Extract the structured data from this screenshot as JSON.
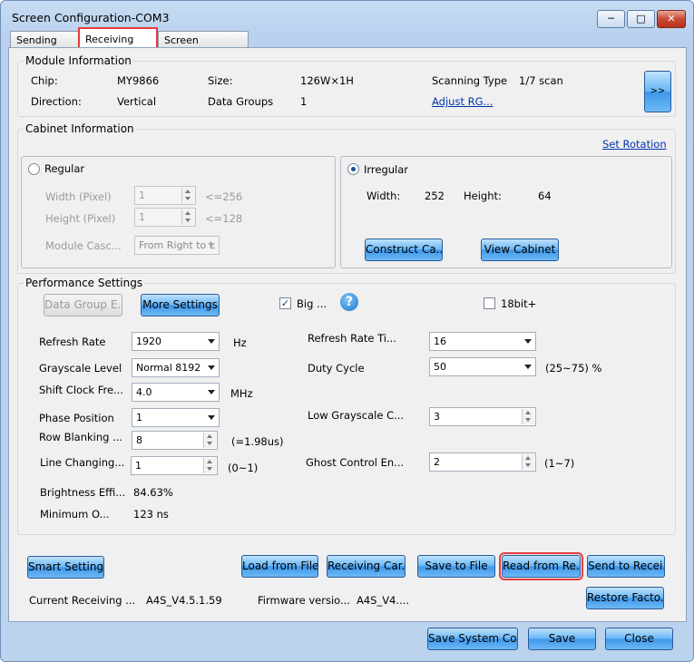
{
  "window": {
    "title": "Screen Configuration-COM3"
  },
  "tabs": [
    {
      "label": "Sending Card"
    },
    {
      "label": "Receiving Card"
    },
    {
      "label": "Screen Connection"
    }
  ],
  "module_info": {
    "legend": "Module Information",
    "chip_label": "Chip:",
    "chip_value": "MY9866",
    "size_label": "Size:",
    "size_value": "126W×1H",
    "scan_label": "Scanning Type",
    "scan_value": "1/7 scan",
    "direction_label": "Direction:",
    "direction_value": "Vertical",
    "groups_label": "Data Groups",
    "groups_value": "1",
    "adjust_link": "Adjust RG...",
    "more_button": ">>"
  },
  "cabinet_info": {
    "legend": "Cabinet Information",
    "set_rotation": "Set Rotation",
    "regular": {
      "label": "Regular",
      "width_label": "Width (Pixel)",
      "width_value": "1",
      "width_limit": "<=256",
      "height_label": "Height (Pixel)",
      "height_value": "1",
      "height_limit": "<=128",
      "cascade_label": "Module Casc...",
      "cascade_value": "From Right to L"
    },
    "irregular": {
      "label": "Irregular",
      "width_label": "Width:",
      "width_value": "252",
      "height_label": "Height:",
      "height_value": "64",
      "construct_button": "Construct Ca...",
      "view_button": "View Cabinet"
    }
  },
  "performance": {
    "legend": "Performance Settings",
    "data_group_button": "Data Group E...",
    "more_settings_button": "More Settings",
    "big_label": "Big ...",
    "bit18_label": "18bit+",
    "help_glyph": "?",
    "refresh_rate_label": "Refresh Rate",
    "refresh_rate_value": "1920",
    "refresh_rate_unit": "Hz",
    "grayscale_label": "Grayscale Level",
    "grayscale_value": "Normal 8192",
    "shift_clock_label": "Shift Clock Fre...",
    "shift_clock_value": "4.0",
    "shift_clock_unit": "MHz",
    "phase_label": "Phase Position",
    "phase_value": "1",
    "row_blanking_label": "Row Blanking ...",
    "row_blanking_value": "8",
    "row_blanking_note": "(=1.98us)",
    "line_changing_label": "Line Changing...",
    "line_changing_value": "1",
    "line_changing_note": "(0~1)",
    "brightness_label": "Brightness Effi...",
    "brightness_value": "84.63%",
    "minimum_label": "Minimum O...",
    "minimum_value": "123 ns",
    "refresh_times_label": "Refresh Rate Ti...",
    "refresh_times_value": "16",
    "duty_label": "Duty Cycle",
    "duty_value": "50",
    "duty_note": "(25~75) %",
    "low_gray_label": "Low Grayscale C...",
    "low_gray_value": "3",
    "ghost_label": "Ghost Control En...",
    "ghost_value": "2",
    "ghost_note": "(1~7)"
  },
  "actions": {
    "smart_settings": "Smart Settings",
    "load_from_file": "Load from File",
    "receiving_card": "Receiving Car...",
    "save_to_file": "Save to File",
    "read_from_receiver": "Read from Re...",
    "send_to_receiver": "Send to Recei...",
    "restore_factory": "Restore Facto...",
    "current_receiving_label": "Current Receiving ...",
    "current_receiving_value": "A4S_V4.5.1.59",
    "firmware_label": "Firmware versio...",
    "firmware_value": "A4S_V4...."
  },
  "footer": {
    "save_system": "Save System Co...",
    "save": "Save",
    "close": "Close"
  },
  "colors": {
    "highlight": "#e53a3a",
    "button_blue": "#4a9eee",
    "link": "#0033aa"
  }
}
